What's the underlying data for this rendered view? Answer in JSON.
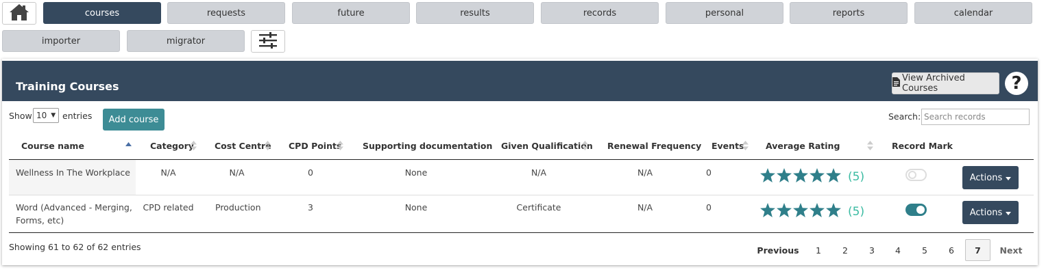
{
  "nav": {
    "home_icon": "home-icon",
    "tabs": [
      "courses",
      "requests",
      "future",
      "results",
      "records",
      "personal",
      "reports",
      "calendar",
      "importer",
      "migrator"
    ],
    "active_tab": "courses",
    "settings_icon": "sliders-icon"
  },
  "panel": {
    "title": "Training Courses",
    "archived_label": "View Archived Courses",
    "archived_icon": "document-icon",
    "help_icon": "help-icon",
    "help_glyph": "?"
  },
  "controls": {
    "show_label": "Show",
    "entries_value": "10",
    "entries_label": "entries",
    "add_label": "Add course",
    "search_label": "Search:",
    "search_placeholder": "Search records"
  },
  "table": {
    "columns": [
      "Course name",
      "Category",
      "Cost Centre",
      "CPD Points",
      "Supporting documentation",
      "Given Qualification",
      "Renewal Frequency",
      "Events",
      "Average Rating",
      "Record Mark"
    ],
    "rows": [
      {
        "course_name_line1": "Wellness In The Workplace",
        "course_name_line2": "",
        "category": "N/A",
        "cost_centre": "N/A",
        "cpd_points": "0",
        "supporting_documentation": "None",
        "given_qualification": "N/A",
        "renewal_frequency": "N/A",
        "events": "0",
        "rating_stars": 5,
        "rating_count": "(5)",
        "record_mark_on": false,
        "actions_label": "Actions"
      },
      {
        "course_name_line1": "Word (Advanced - Merging,",
        "course_name_line2": "Forms, etc)",
        "category": "CPD related",
        "cost_centre": "Production",
        "cpd_points": "3",
        "supporting_documentation": "None",
        "given_qualification": "Certificate",
        "renewal_frequency": "N/A",
        "events": "0",
        "rating_stars": 5,
        "rating_count": "(5)",
        "record_mark_on": true,
        "actions_label": "Actions"
      }
    ]
  },
  "footer": {
    "info": "Showing 61 to 62 of 62 entries",
    "previous": "Previous",
    "pages": [
      "1",
      "2",
      "3",
      "4",
      "5",
      "6",
      "7"
    ],
    "current_page": "7",
    "next": "Next"
  },
  "colors": {
    "header_bg": "#35495e",
    "accent_teal": "#3d8c95",
    "star": "#2f7f8a",
    "rating_text": "#3bbba2",
    "toggle_on": "#2f7f8a"
  }
}
